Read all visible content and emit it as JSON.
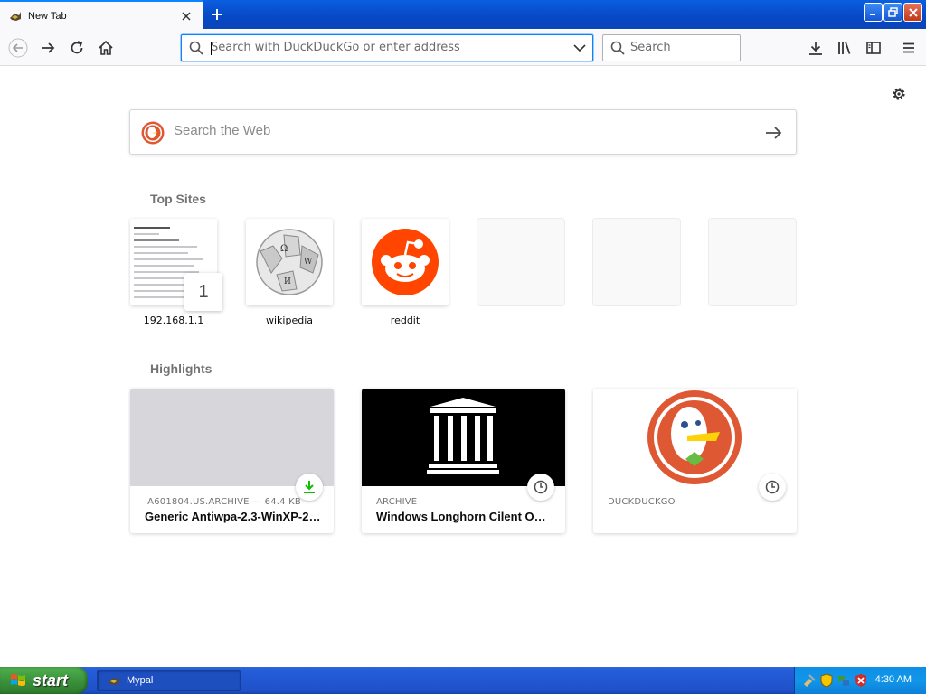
{
  "browser": {
    "tab_title": "New Tab",
    "url_placeholder": "Search with DuckDuckGo or enter address",
    "search_placeholder": "Search"
  },
  "newtab": {
    "websearch_placeholder": "Search the Web",
    "top_sites_title": "Top Sites",
    "top_sites": [
      {
        "label": "192.168.1.1",
        "icon": "router-page-thumbnail",
        "badge": "1"
      },
      {
        "label": "wikipedia",
        "icon": "wikipedia-globe-icon"
      },
      {
        "label": "reddit",
        "icon": "reddit-alien-icon"
      }
    ],
    "highlights_title": "Highlights",
    "highlights": [
      {
        "meta": "IA601804.US.ARCHIVE — 64.4 KB",
        "title": "Generic Antiwpa-2.3-WinXP-2k...",
        "badge": "download-icon"
      },
      {
        "meta": "ARCHIVE",
        "title": "Windows Longhorn Cilent Ome...",
        "badge": "clock-icon"
      },
      {
        "meta": "DUCKDUCKGO",
        "title": "",
        "badge": "clock-icon"
      }
    ]
  },
  "taskbar": {
    "start_label": "start",
    "task_label": "Mypal",
    "clock": "4:30 AM"
  },
  "colors": {
    "accent": "#0a84ff",
    "reddit": "#ff4500",
    "duckduckgo": "#de5833",
    "download_green": "#12bc00"
  }
}
